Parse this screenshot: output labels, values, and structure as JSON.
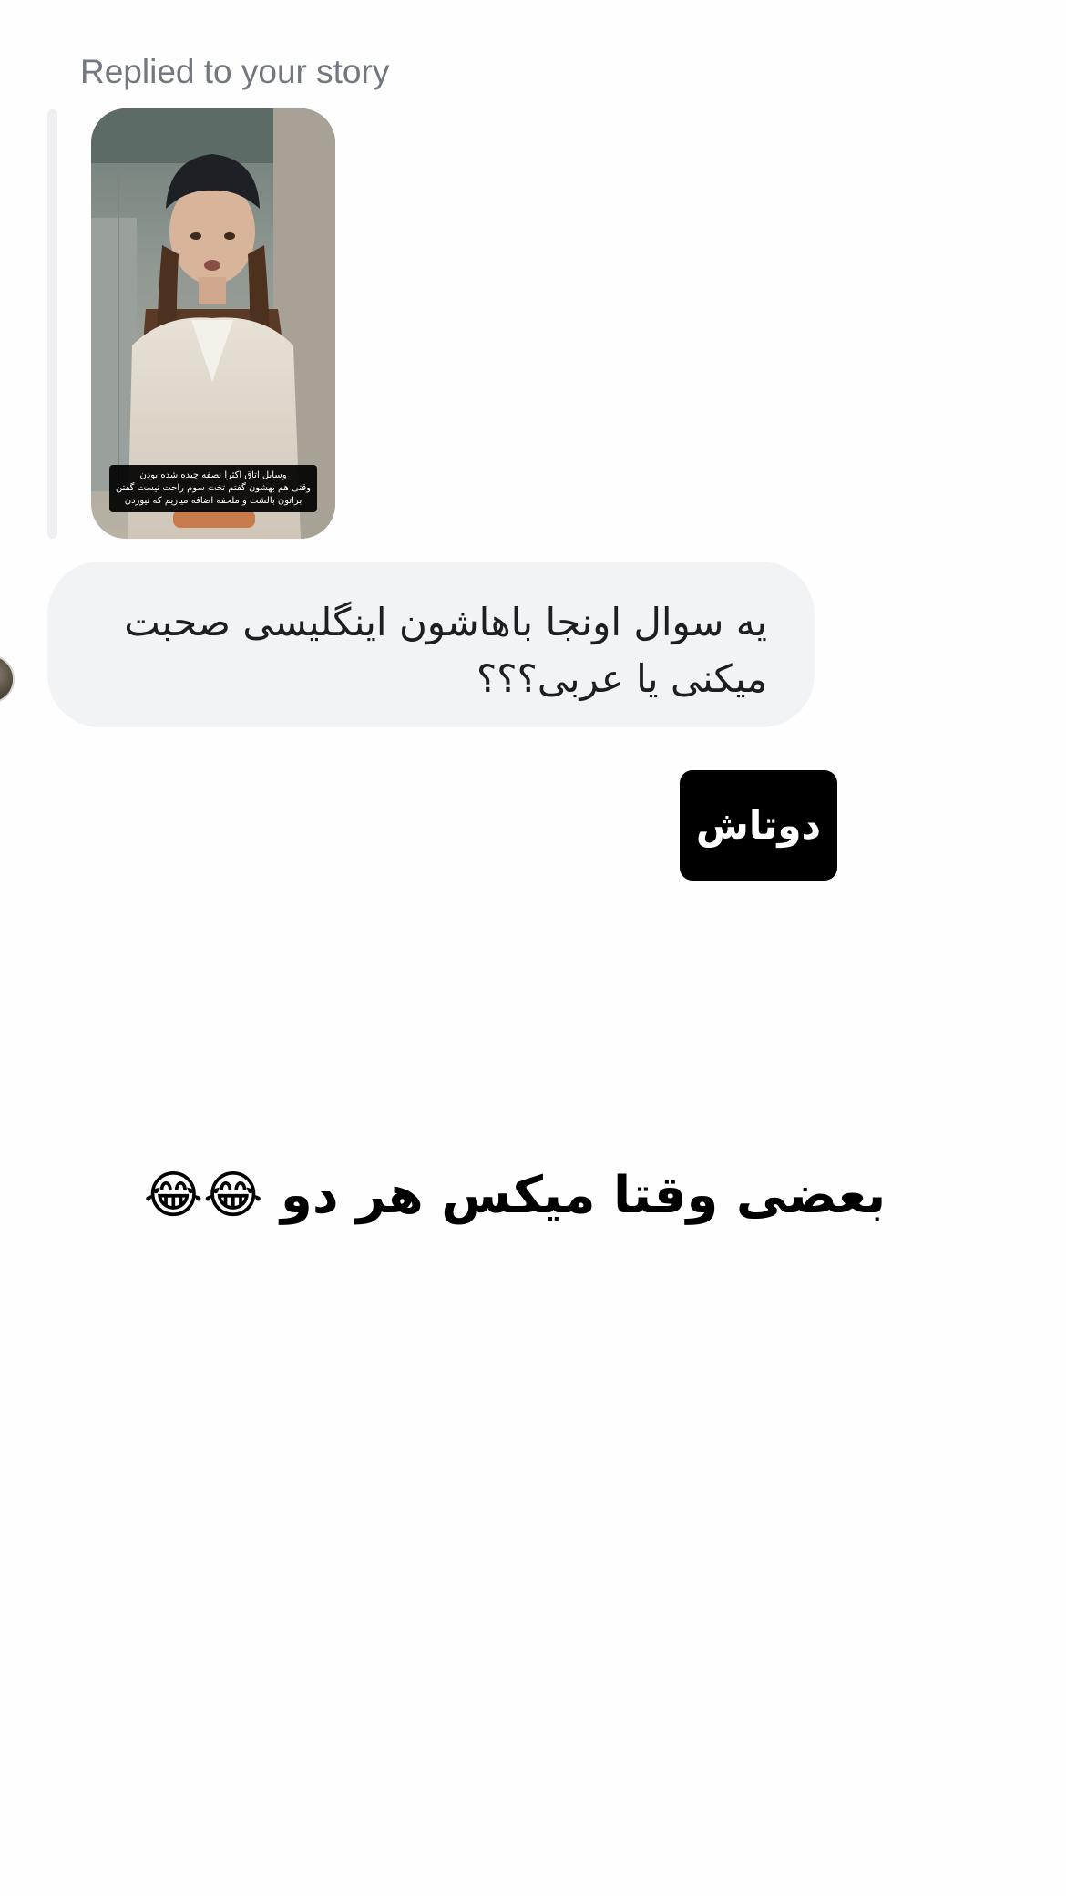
{
  "reply_header": "Replied to your story",
  "story": {
    "caption_lines": [
      "وسایل اتاق اکثرا نصفه چیده شده بودن",
      "وقتی هم بهشون گفتم تخت سوم راحت نیست گفتن",
      "براتون بالشت و ملحفه اضافه میاریم که نیوردن"
    ]
  },
  "message": {
    "text": "یه سوال اونجا باهاشون اینگلیسی صحبت میکنی یا عربی؟؟؟"
  },
  "sticker": {
    "label": "دوتاش"
  },
  "overlay": {
    "text": "بعضی وقتا میکس هر دو 😂😂"
  }
}
